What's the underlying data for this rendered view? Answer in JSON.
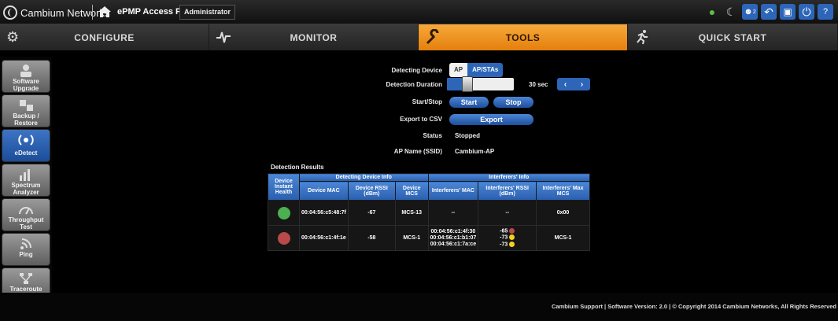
{
  "header": {
    "brand": "Cambium Networks",
    "product": "ePMP Access Point",
    "role": "Administrator",
    "icons": [
      "globe-icon",
      "satellite-icon",
      "user-notification-icon",
      "undo-icon",
      "save-icon",
      "power-icon",
      "help-icon"
    ],
    "badge_count": "2"
  },
  "nav": {
    "tabs": [
      {
        "label": "CONFIGURE",
        "icon": "gear-icon"
      },
      {
        "label": "MONITOR",
        "icon": "pulse-icon"
      },
      {
        "label": "TOOLS",
        "icon": "wrench-icon"
      },
      {
        "label": "QUICK START",
        "icon": "runner-icon"
      }
    ],
    "active": "TOOLS"
  },
  "sidebar": {
    "items": [
      {
        "label": "Software Upgrade",
        "icon": "software-upgrade-icon"
      },
      {
        "label": "Backup / Restore",
        "icon": "backup-restore-icon"
      },
      {
        "label": "eDetect",
        "icon": "edetect-icon"
      },
      {
        "label": "Spectrum Analyzer",
        "icon": "spectrum-analyzer-icon"
      },
      {
        "label": "Throughput Test",
        "icon": "throughput-icon"
      },
      {
        "label": "Ping",
        "icon": "ping-icon"
      },
      {
        "label": "Traceroute",
        "icon": "traceroute-icon"
      }
    ],
    "active": "eDetect"
  },
  "form": {
    "detecting_device_label": "Detecting Device",
    "detecting_device_options": [
      "AP",
      "AP/STAs"
    ],
    "detecting_device_selected": "AP/STAs",
    "duration_label": "Detection Duration",
    "duration_value": "30 sec",
    "duration_level": 0.3,
    "start_stop_label": "Start/Stop",
    "start_button": "Start",
    "stop_button": "Stop",
    "export_label": "Export to CSV",
    "export_button": "Export",
    "status_label": "Status",
    "status_value": "Stopped",
    "ap_name_label": "AP Name (SSID)",
    "ap_name_value": "Cambium-AP"
  },
  "results": {
    "title": "Detection Results",
    "group_headers": [
      "Detecting Device Info",
      "Interferers' Info"
    ],
    "health_header": "Device Instant Health",
    "columns": [
      "Device MAC",
      "Device RSSI (dBm)",
      "Device MCS",
      "Interferers' MAC",
      "Interferers' RSSI (dBm)",
      "Interferers' Max MCS"
    ],
    "rows": [
      {
        "health": "green",
        "mac": "00:04:56:c5:48:7f",
        "rssi": "-67",
        "mcs": "MCS-13",
        "int_macs": [
          "--"
        ],
        "int_rssi": [
          {
            "value": "--",
            "color": ""
          }
        ],
        "int_mcs": "0x00"
      },
      {
        "health": "red",
        "mac": "00:04:56:c1:4f:1e",
        "rssi": "-58",
        "mcs": "MCS-1",
        "int_macs": [
          "00:04:56:c1:4f:30",
          "00:04:56:c1:b1:07",
          "00:04:56:c1:7a:ce"
        ],
        "int_rssi": [
          {
            "value": "-65",
            "color": "red"
          },
          {
            "value": "-73",
            "color": "yellow"
          },
          {
            "value": "-73",
            "color": "yellow"
          }
        ],
        "int_mcs": "MCS-1"
      }
    ]
  },
  "footer": {
    "text": "Cambium Support  |  Software Version:  2.0    |  © Copyright 2014 Cambium Networks, All Rights Reserved"
  },
  "colors": {
    "accent_orange": "#e88a17",
    "accent_blue": "#2d66b8",
    "health_green": "#4caf50",
    "health_red": "#b84a4a",
    "rssi_yellow": "#f2d21b"
  }
}
